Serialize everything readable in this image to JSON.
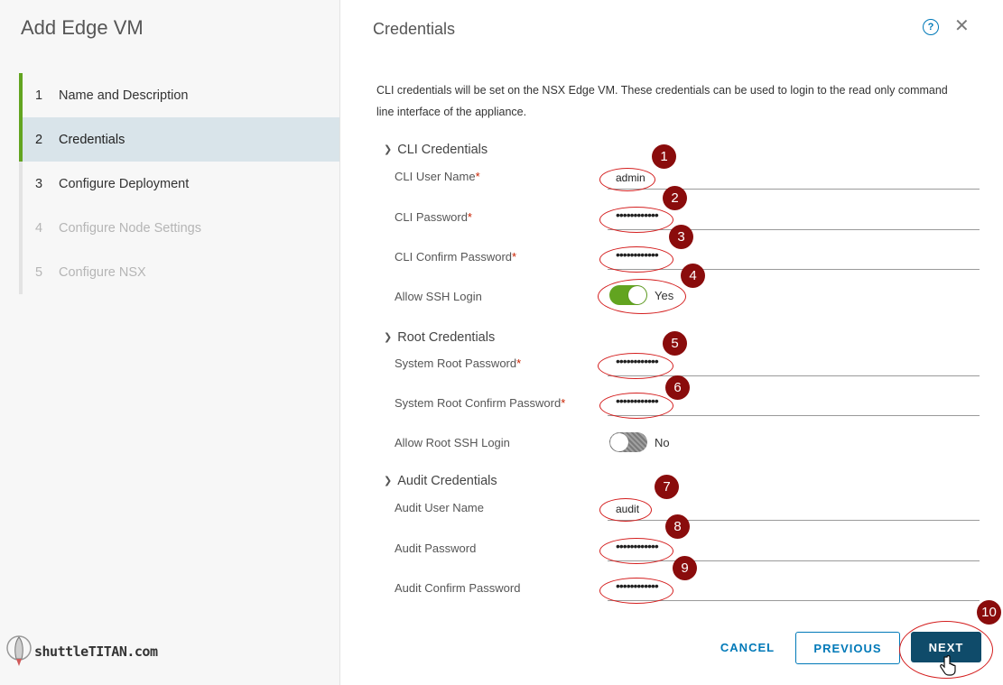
{
  "wizard": {
    "title": "Add Edge VM",
    "steps": [
      {
        "num": "1",
        "label": "Name and Description"
      },
      {
        "num": "2",
        "label": "Credentials"
      },
      {
        "num": "3",
        "label": "Configure Deployment"
      },
      {
        "num": "4",
        "label": "Configure Node Settings"
      },
      {
        "num": "5",
        "label": "Configure NSX"
      }
    ],
    "active_step": 2
  },
  "logo": {
    "text": "shuttleTITAN.com"
  },
  "panel": {
    "title": "Credentials",
    "help_icon": "question-circle-icon",
    "close_icon": "close-icon",
    "description": "CLI credentials will be set on the NSX Edge VM. These credentials can be used to login to the read only command line interface of the appliance."
  },
  "sections": {
    "cli": {
      "title": "CLI Credentials",
      "user_label": "CLI User Name",
      "user_value": "admin",
      "password_label": "CLI Password",
      "password_value": "••••••••••••",
      "confirm_label": "CLI Confirm Password",
      "confirm_value": "••••••••••••",
      "ssh_label": "Allow SSH Login",
      "ssh_state": "Yes"
    },
    "root": {
      "title": "Root Credentials",
      "password_label": "System Root Password",
      "password_value": "••••••••••••",
      "confirm_label": "System Root Confirm Password",
      "confirm_value": "••••••••••••",
      "ssh_label": "Allow Root SSH Login",
      "ssh_state": "No"
    },
    "audit": {
      "title": "Audit Credentials",
      "user_label": "Audit User Name",
      "user_value": "audit",
      "password_label": "Audit Password",
      "password_value": "••••••••••••",
      "confirm_label": "Audit Confirm Password",
      "confirm_value": "••••••••••••"
    }
  },
  "required_mark": "*",
  "annotations": [
    "1",
    "2",
    "3",
    "4",
    "5",
    "6",
    "7",
    "8",
    "9",
    "10"
  ],
  "buttons": {
    "cancel": "CANCEL",
    "previous": "PREVIOUS",
    "next": "NEXT"
  },
  "colors": {
    "accent": "#0079b8",
    "primary_button": "#0f4b6a",
    "toggle_on": "#62a420",
    "annotation": "#8a0c0c",
    "ring": "#d41e1e"
  }
}
